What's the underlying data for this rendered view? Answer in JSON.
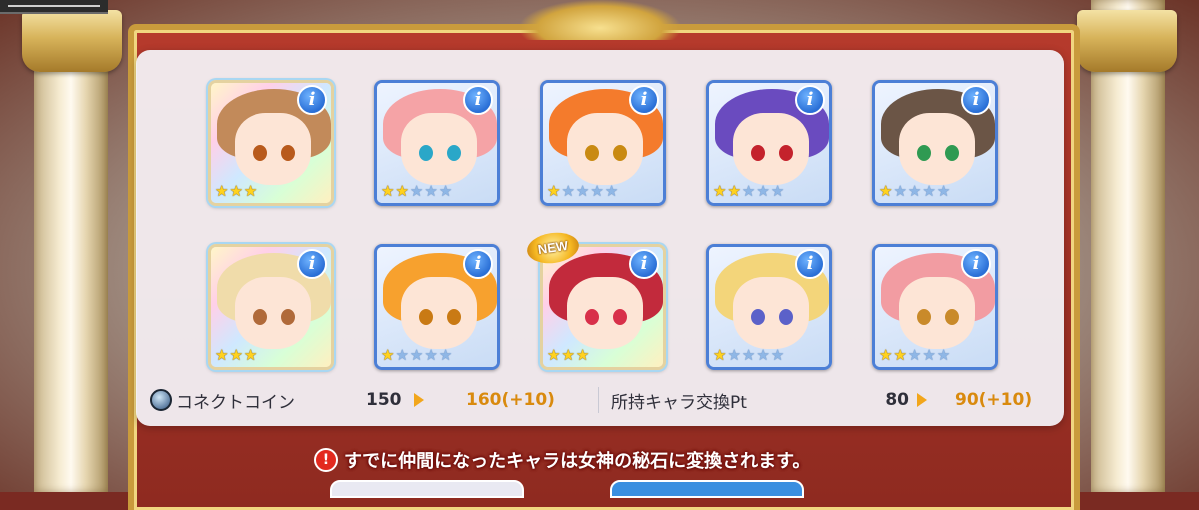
{
  "colors": {
    "card_border": "#4c7fd6",
    "panel_bg": "#f3f2f6",
    "accent_gold": "#d98a0e",
    "warning_red": "#e32a1f"
  },
  "info_button_label": "i",
  "new_badge_label": "NEW",
  "characters": [
    {
      "stars": 3,
      "max_stars": 3,
      "rainbow": true,
      "is_new": false,
      "hair": "#c28a5a",
      "eyes": "#b85a1c"
    },
    {
      "stars": 2,
      "max_stars": 5,
      "rainbow": false,
      "is_new": false,
      "hair": "#f5a3a6",
      "eyes": "#2aa7c8"
    },
    {
      "stars": 1,
      "max_stars": 5,
      "rainbow": false,
      "is_new": false,
      "hair": "#f47b2c",
      "eyes": "#c98a12"
    },
    {
      "stars": 2,
      "max_stars": 5,
      "rainbow": false,
      "is_new": false,
      "hair": "#6a4bbf",
      "eyes": "#c4222c"
    },
    {
      "stars": 1,
      "max_stars": 5,
      "rainbow": false,
      "is_new": false,
      "hair": "#6b5546",
      "eyes": "#2f9a52"
    },
    {
      "stars": 3,
      "max_stars": 3,
      "rainbow": true,
      "is_new": false,
      "hair": "#f0dcaa",
      "eyes": "#b06a3a"
    },
    {
      "stars": 1,
      "max_stars": 5,
      "rainbow": false,
      "is_new": false,
      "hair": "#f7a12e",
      "eyes": "#c97a14"
    },
    {
      "stars": 3,
      "max_stars": 3,
      "rainbow": true,
      "is_new": true,
      "hair": "#c22a3c",
      "eyes": "#d8304a"
    },
    {
      "stars": 1,
      "max_stars": 5,
      "rainbow": false,
      "is_new": false,
      "hair": "#f3d57a",
      "eyes": "#5b61c9"
    },
    {
      "stars": 2,
      "max_stars": 5,
      "rainbow": false,
      "is_new": false,
      "hair": "#f29ca2",
      "eyes": "#c98a2a"
    }
  ],
  "connect_coin": {
    "label": "コネクトコイン",
    "icon": "coin-icon",
    "current": "150",
    "after": "160(+10)"
  },
  "exchange_pt": {
    "label": "所持キャラ交換Pt",
    "current": "80",
    "after": "90(+10)"
  },
  "warning": {
    "icon": "exclamation-icon",
    "text": "すでに仲間になったキャラは女神の秘石に変換されます。"
  }
}
